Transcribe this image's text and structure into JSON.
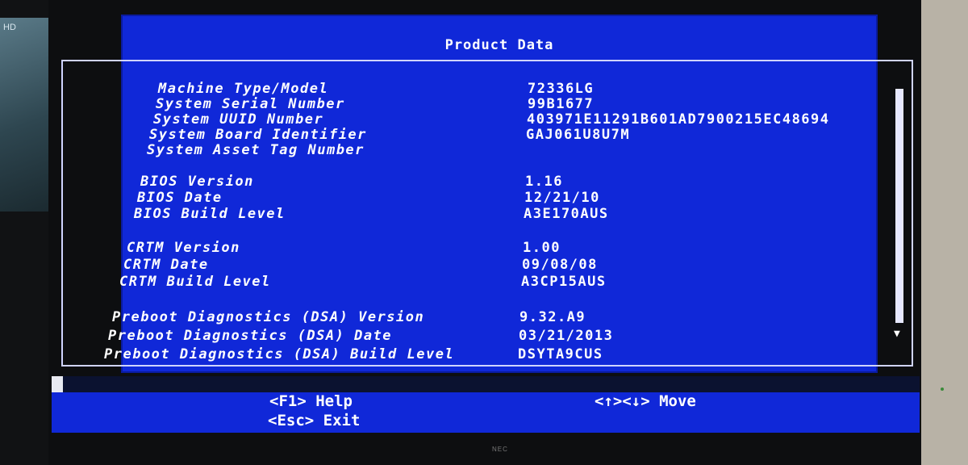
{
  "header": {
    "title": "Product Data"
  },
  "rows": [
    {
      "label": "Machine Type/Model",
      "value": "72336LG"
    },
    {
      "label": "System Serial Number",
      "value": "99B1677"
    },
    {
      "label": "System UUID Number",
      "value": "403971E11291B601AD7900215EC48694"
    },
    {
      "label": "System Board Identifier",
      "value": "GAJ061U8U7M"
    },
    {
      "label": "System Asset Tag Number",
      "value": ""
    },
    {
      "label": "BIOS Version",
      "value": "1.16"
    },
    {
      "label": "BIOS Date",
      "value": "12/21/10"
    },
    {
      "label": "BIOS Build Level",
      "value": "A3E170AUS"
    },
    {
      "label": "CRTM Version",
      "value": "1.00"
    },
    {
      "label": "CRTM Date",
      "value": "09/08/08"
    },
    {
      "label": "CRTM Build Level",
      "value": "A3CP15AUS"
    },
    {
      "label": "Preboot Diagnostics (DSA) Version",
      "value": "9.32.A9"
    },
    {
      "label": "Preboot Diagnostics (DSA) Date",
      "value": "03/21/2013"
    },
    {
      "label": "Preboot Diagnostics (DSA) Build Level",
      "value": "DSYTA9CUS"
    }
  ],
  "footer": {
    "help": "<F1>  Help",
    "exit": "<Esc> Exit",
    "move": "<↑><↓> Move"
  },
  "icons": {
    "scroll_down": "scroll-down-arrow-icon"
  },
  "colors": {
    "screen_bg": "#1028d8",
    "text": "#ffffff",
    "bezel": "#0d0e10"
  },
  "monitor": {
    "brand": "NEC",
    "side_label": "HD"
  }
}
